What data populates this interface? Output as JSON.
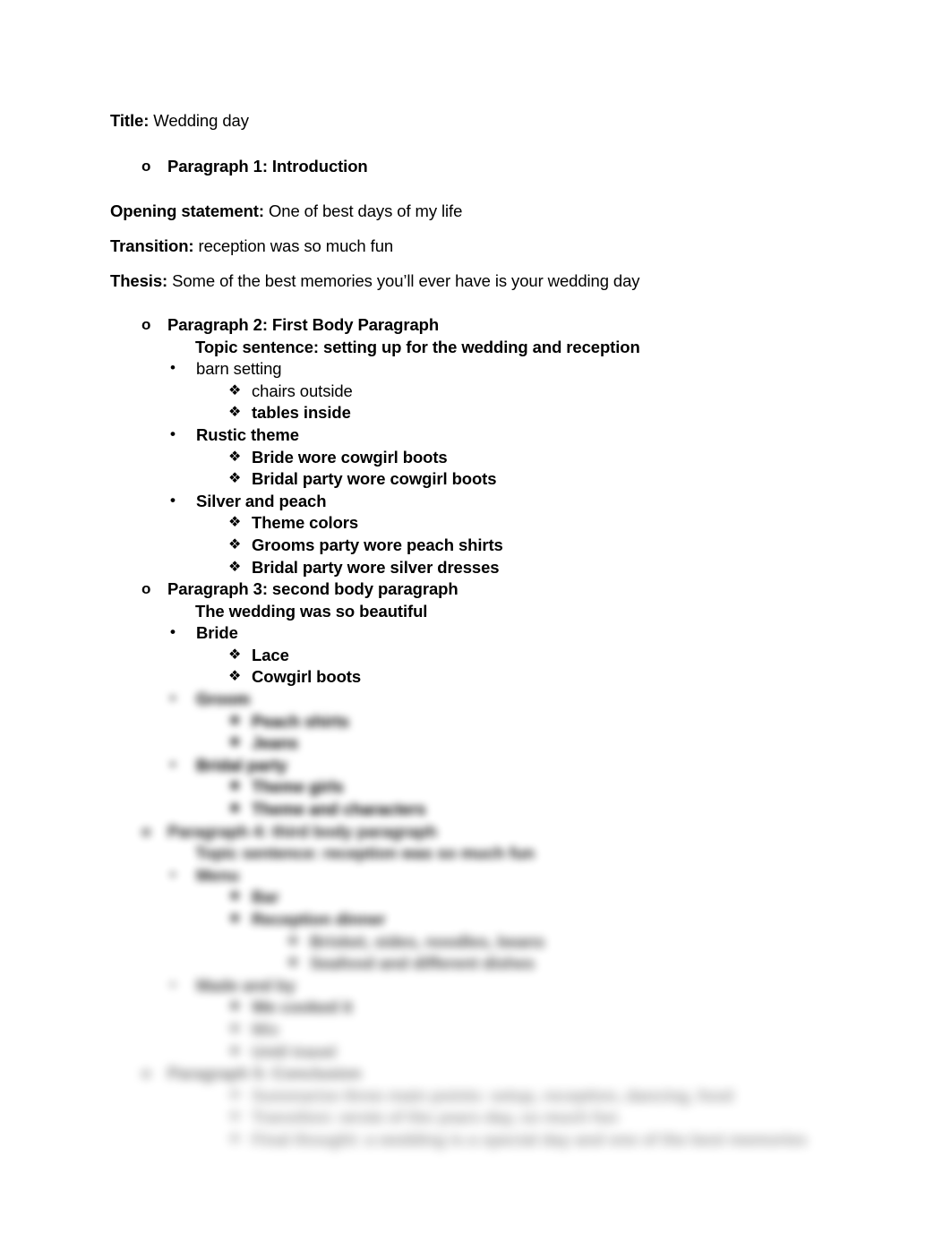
{
  "document": {
    "title_label": "Title:",
    "title_value": " Wedding day",
    "opening_label": "Opening statement:",
    "opening_value": " One of best days of my life",
    "transition_label": "Transition:",
    "transition_value": " reception was so much fun",
    "thesis_label": "Thesis:",
    "thesis_value": " Some of the best memories you’ll ever have is your wedding day",
    "markers": {
      "level1": "o",
      "level2": "•",
      "level3": "❖",
      "level4": "❖"
    },
    "outline": [
      {
        "level": 1,
        "bold": true,
        "text": "Paragraph 1: Introduction"
      },
      {
        "level": 1,
        "bold": true,
        "text": "Paragraph 2: First Body Paragraph"
      },
      {
        "level": "cont",
        "bold": true,
        "text": "Topic sentence: setting up for the wedding and reception"
      },
      {
        "level": 2,
        "bold": false,
        "text": "barn setting"
      },
      {
        "level": 3,
        "bold": false,
        "text": "chairs outside"
      },
      {
        "level": 3,
        "bold": true,
        "text": "tables inside"
      },
      {
        "level": 2,
        "bold": true,
        "text": "Rustic theme"
      },
      {
        "level": 3,
        "bold": true,
        "text": "Bride wore cowgirl boots"
      },
      {
        "level": 3,
        "bold": true,
        "text": "Bridal party wore cowgirl boots"
      },
      {
        "level": 2,
        "bold": true,
        "text": "Silver and peach"
      },
      {
        "level": 3,
        "bold": true,
        "text": "Theme colors"
      },
      {
        "level": 3,
        "bold": true,
        "text": "Grooms party wore peach shirts"
      },
      {
        "level": 3,
        "bold": true,
        "text": "Bridal party wore silver dresses"
      },
      {
        "level": 1,
        "bold": true,
        "text": "Paragraph 3: second body paragraph"
      },
      {
        "level": "cont",
        "bold": true,
        "text": "The wedding was so beautiful"
      },
      {
        "level": 2,
        "bold": true,
        "text": "Bride"
      },
      {
        "level": 3,
        "bold": true,
        "text": "Lace"
      },
      {
        "level": 3,
        "bold": true,
        "text": "Cowgirl boots"
      }
    ],
    "redacted_note": "Lower portion of the outline is blurred and unreadable in the source image.",
    "redacted_outline": [
      {
        "level": 2,
        "blur": 1,
        "marker_sharp": true,
        "text": "Groom"
      },
      {
        "level": 3,
        "blur": 1,
        "marker_sharp": false,
        "text": "Peach shirts"
      },
      {
        "level": 3,
        "blur": 1,
        "marker_sharp": false,
        "text": "Jeans"
      },
      {
        "level": 2,
        "blur": 1,
        "marker_sharp": false,
        "text": "Bridal party"
      },
      {
        "level": 3,
        "blur": 1,
        "marker_sharp": false,
        "text": "Theme girls"
      },
      {
        "level": 3,
        "blur": 1,
        "marker_sharp": false,
        "text": "Theme and characters"
      },
      {
        "level": 1,
        "blur": 2,
        "marker_sharp": false,
        "text": "Paragraph 4: third body paragraph"
      },
      {
        "level": "cont",
        "blur": 2,
        "marker_sharp": false,
        "text": "Topic sentence: reception was so much fun"
      },
      {
        "level": 2,
        "blur": 2,
        "marker_sharp": false,
        "text": "Menu"
      },
      {
        "level": 3,
        "blur": 2,
        "marker_sharp": false,
        "text": "Bar"
      },
      {
        "level": 3,
        "blur": 2,
        "marker_sharp": false,
        "text": "Reception dinner"
      },
      {
        "level": 4,
        "blur": 3,
        "marker_sharp": false,
        "text": "Brisket, sides, noodles, beans"
      },
      {
        "level": 4,
        "blur": 3,
        "marker_sharp": false,
        "text": "Seafood and different dishes"
      },
      {
        "level": 2,
        "blur": 3,
        "marker_sharp": false,
        "text": "Made and by"
      },
      {
        "level": 3,
        "blur": 3,
        "marker_sharp": false,
        "text": "We cooked it"
      },
      {
        "level": 3,
        "blur": 4,
        "marker_sharp": false,
        "text": "Mix"
      },
      {
        "level": 3,
        "blur": 4,
        "marker_sharp": false,
        "text": "Until travel"
      },
      {
        "level": 1,
        "blur": 4,
        "marker_sharp": false,
        "text": "Paragraph 5: Conclusion"
      },
      {
        "level": 3,
        "blur": 5,
        "marker_sharp": false,
        "text": "Summarize three main points: setup, reception, dancing, food"
      },
      {
        "level": 3,
        "blur": 5,
        "marker_sharp": false,
        "text": "Transition: wrote of the years day, so much fun"
      },
      {
        "level": 3,
        "blur": 5,
        "marker_sharp": false,
        "text": "Final thought: a wedding is a special day and one of the best memories"
      }
    ]
  }
}
